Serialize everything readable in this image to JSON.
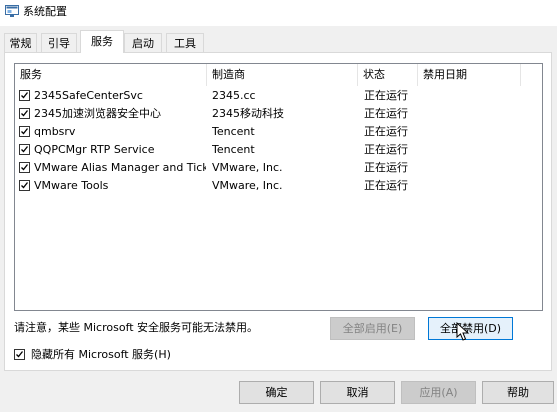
{
  "window": {
    "title": "系统配置",
    "icon": "msconfig-icon"
  },
  "tabs": [
    {
      "label": "常规",
      "active": false
    },
    {
      "label": "引导",
      "active": false
    },
    {
      "label": "服务",
      "active": true
    },
    {
      "label": "启动",
      "active": false
    },
    {
      "label": "工具",
      "active": false
    }
  ],
  "services": {
    "columns": [
      "服务",
      "制造商",
      "状态",
      "禁用日期"
    ],
    "rows": [
      {
        "name": "2345SafeCenterSvc",
        "vendor": "2345.cc",
        "status": "正在运行",
        "checked": true
      },
      {
        "name": "2345加速浏览器安全中心",
        "vendor": "2345移动科技",
        "status": "正在运行",
        "checked": true
      },
      {
        "name": "qmbsrv",
        "vendor": "Tencent",
        "status": "正在运行",
        "checked": true
      },
      {
        "name": "QQPCMgr RTP Service",
        "vendor": "Tencent",
        "status": "正在运行",
        "checked": true
      },
      {
        "name": "VMware Alias Manager and Tick...",
        "vendor": "VMware, Inc.",
        "status": "正在运行",
        "checked": true
      },
      {
        "name": "VMware Tools",
        "vendor": "VMware, Inc.",
        "status": "正在运行",
        "checked": true
      }
    ]
  },
  "note": "请注意，某些 Microsoft 安全服务可能无法禁用。",
  "buttons": {
    "enable_all": "全部启用(E)",
    "disable_all": "全部禁用(D)",
    "ok": "确定",
    "cancel": "取消",
    "apply": "应用(A)",
    "help": "帮助"
  },
  "hide_ms": {
    "label": "隐藏所有 Microsoft 服务(H)",
    "checked": true
  }
}
